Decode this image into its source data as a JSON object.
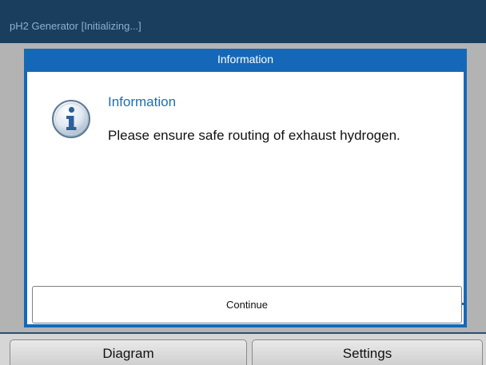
{
  "app": {
    "title": "pH2 Generator  [Initializing...]"
  },
  "dialog": {
    "window_title": "Information",
    "heading": "Information",
    "message": "Please ensure safe routing of exhaust hydrogen.",
    "icon": "info-icon",
    "continue_label": "Continue"
  },
  "bottom_tabs": [
    {
      "label": "Diagram"
    },
    {
      "label": "Settings"
    }
  ],
  "colors": {
    "title_bar": "#193e5e",
    "dialog_frame": "#1568b8",
    "heading_text": "#1a6fb5",
    "background": "#b3b3b3"
  }
}
